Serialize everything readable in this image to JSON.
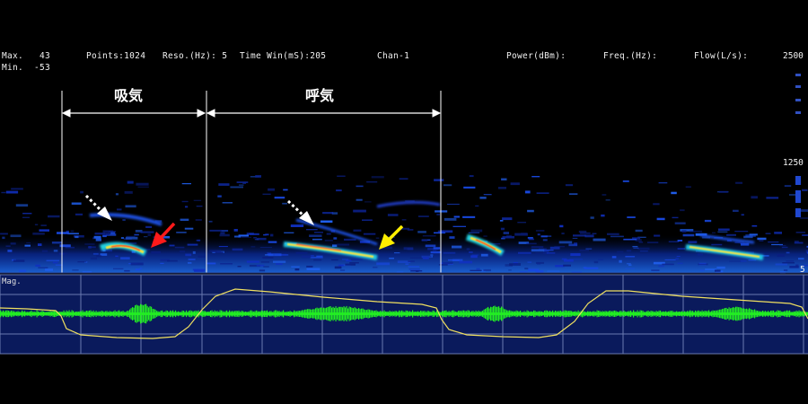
{
  "header": {
    "max_label": "Max.",
    "max_value": "43",
    "min_label": "Min.",
    "min_value": "-53",
    "points": "Points:1024",
    "reso": "Reso.(Hz): 5",
    "time_win": "Time Win(mS):205",
    "channel": "Chan-1",
    "power": "Power(dBm):",
    "freq": "Freq.(Hz):",
    "flow": "Flow(L/s):"
  },
  "spectrogram": {
    "y_axis_labels": {
      "top": "2500",
      "mid": "1250",
      "bottom": "5"
    },
    "phases": [
      {
        "label": "吸気"
      },
      {
        "label": "呼気"
      }
    ],
    "arrows": [
      {
        "kind": "dotted",
        "color": "#ffffff"
      },
      {
        "kind": "solid",
        "color": "#ff2020"
      },
      {
        "kind": "dotted",
        "color": "#ffffff"
      },
      {
        "kind": "solid",
        "color": "#ffee00"
      }
    ]
  },
  "lower_panel": {
    "label": "Mag.",
    "background": "#0a1a5c",
    "grid_color": "#6a7ab0",
    "signal_color": "#22ee22",
    "flow_color": "#f0e060"
  },
  "colors": {
    "background": "#000000",
    "spectral_low": "#1030c0",
    "spectral_mid": "#20d0e0",
    "spectral_high": "#ff4020"
  }
}
